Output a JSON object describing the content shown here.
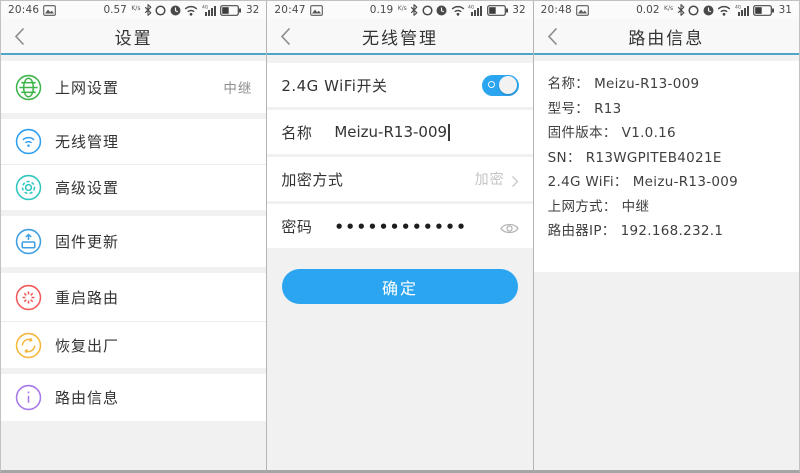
{
  "ui": {
    "colon": "："
  },
  "colors": {
    "accent_line": "#4fa5c8",
    "primary_blue": "#2ba5f0",
    "icon_green": "#3db54b",
    "icon_blue": "#2f9ff0",
    "icon_teal": "#2fc6c0",
    "icon_lightblue": "#3e9fe0",
    "icon_red": "#f25a5a",
    "icon_amber": "#f5b73d",
    "icon_purple": "#a678e8"
  },
  "panels": [
    {
      "name": "settings",
      "status": {
        "time": "20:46",
        "net_speed": "0.57",
        "net_speed_unit": "K/s",
        "battery_percent": "32"
      },
      "header": {
        "title": "设置"
      },
      "menu": [
        {
          "icon": "globe-icon",
          "label": "上网设置",
          "value": "中继"
        },
        {
          "icon": "wifi-icon",
          "label": "无线管理"
        },
        {
          "icon": "gear-icon",
          "label": "高级设置"
        },
        {
          "icon": "firmware-icon",
          "label": "固件更新"
        },
        {
          "icon": "restart-icon",
          "label": "重启路由"
        },
        {
          "icon": "factory-reset-icon",
          "label": "恢复出厂"
        },
        {
          "icon": "info-icon",
          "label": "路由信息"
        }
      ]
    },
    {
      "name": "wireless-management",
      "status": {
        "time": "20:47",
        "net_speed": "0.19",
        "net_speed_unit": "K/s",
        "battery_percent": "32"
      },
      "header": {
        "title": "无线管理"
      },
      "form": {
        "wifi_switch": {
          "label": "2.4G WiFi开关",
          "state": "on"
        },
        "ssid": {
          "label": "名称",
          "value": "Meizu-R13-009"
        },
        "encryption": {
          "label": "加密方式",
          "value": "加密"
        },
        "password": {
          "label": "密码",
          "masked_value": "••••••••••••"
        },
        "submit_label": "确定"
      }
    },
    {
      "name": "router-info",
      "status": {
        "time": "20:48",
        "net_speed": "0.02",
        "net_speed_unit": "K/s",
        "battery_percent": "31"
      },
      "header": {
        "title": "路由信息"
      },
      "info": [
        {
          "label": "名称",
          "value": "Meizu-R13-009"
        },
        {
          "label": "型号",
          "value": "R13"
        },
        {
          "label": "固件版本",
          "value": "V1.0.16"
        },
        {
          "label": "SN",
          "value": "R13WGPITEB4021E"
        },
        {
          "label": "2.4G WiFi",
          "value": "Meizu-R13-009"
        },
        {
          "label": "上网方式",
          "value": "中继"
        },
        {
          "label": "路由器IP",
          "value": "192.168.232.1"
        }
      ]
    }
  ]
}
